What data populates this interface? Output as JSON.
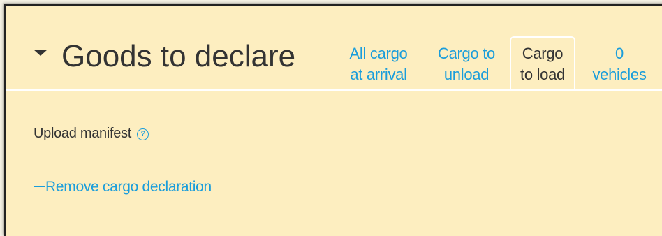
{
  "section": {
    "title": "Goods to declare",
    "toggle_icon": "caret-down-icon"
  },
  "tabs": [
    {
      "line1": "All cargo",
      "line2": "at arrival",
      "active": false
    },
    {
      "line1": "Cargo to",
      "line2": "unload",
      "active": false
    },
    {
      "line1": "Cargo",
      "line2": "to load",
      "active": true
    },
    {
      "line1": "0",
      "line2": "vehicles",
      "active": false
    }
  ],
  "upload": {
    "label": "Upload manifest",
    "help_icon": "question-circle-icon",
    "help_glyph": "?"
  },
  "remove": {
    "label": "Remove cargo declaration",
    "icon": "minus-icon"
  },
  "colors": {
    "panel_background": "#fdeec0",
    "link": "#1a9ddb",
    "text": "#333333"
  }
}
